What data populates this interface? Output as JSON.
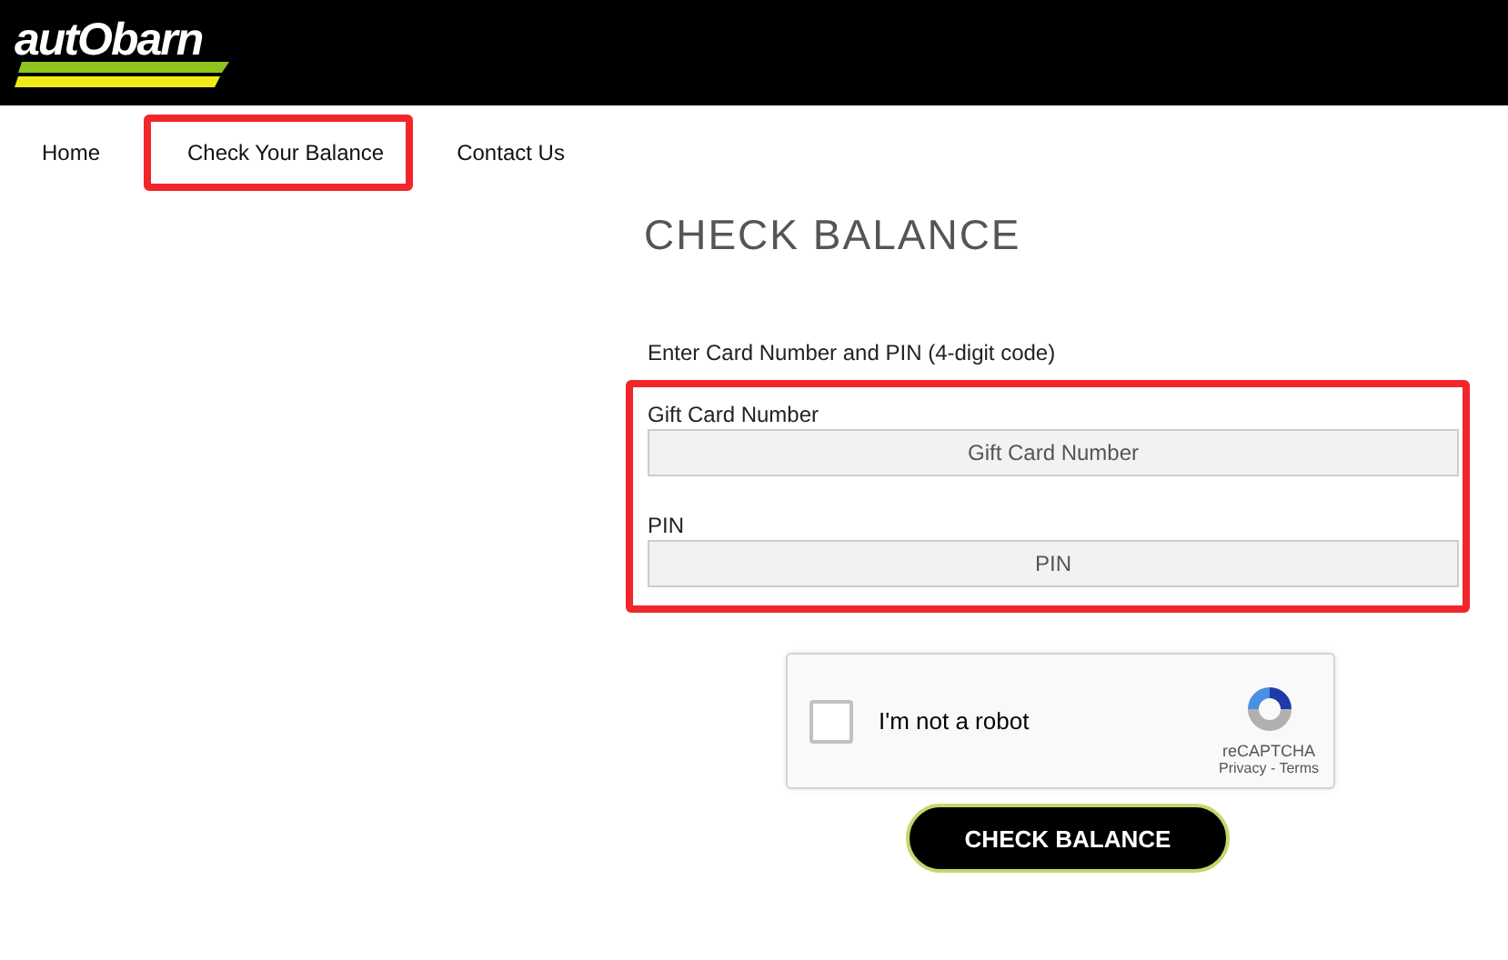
{
  "logo": {
    "text": "autObarn"
  },
  "nav": [
    {
      "label": "Home",
      "highlighted": false
    },
    {
      "label": "Check Your Balance",
      "highlighted": true
    },
    {
      "label": "Contact Us",
      "highlighted": false
    }
  ],
  "title": "CHECK BALANCE",
  "instructions": "Enter Card Number and PIN (4-digit code)",
  "fields_highlighted": true,
  "fields": [
    {
      "label": "Gift Card Number",
      "placeholder": "Gift Card Number"
    },
    {
      "label": "PIN",
      "placeholder": "PIN"
    }
  ],
  "captcha": {
    "label": "I'm not a robot",
    "checked": false,
    "brand": "reCAPTCHA",
    "links": [
      "Privacy",
      "Terms"
    ],
    "link_separator": "-"
  },
  "submit": "CHECK BALANCE"
}
